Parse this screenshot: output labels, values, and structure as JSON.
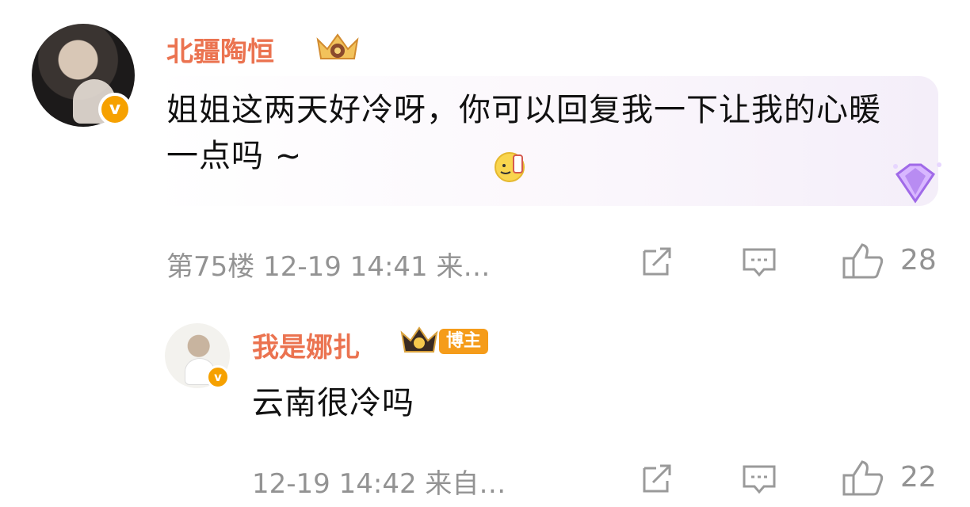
{
  "comments": [
    {
      "username": "北疆陶恒",
      "text": "姐姐这两天好冷呀，你可以回复我一下让我的心暖一点吗 ~",
      "meta": "第75楼 12-19 14:41 来…",
      "likes": "28",
      "icons": [
        "crown-badge-icon",
        "verified-icon",
        "emoji-icon",
        "diamond-icon",
        "share-icon",
        "comment-icon",
        "like-icon"
      ]
    },
    {
      "username": "我是娜扎",
      "badge": "博主",
      "text": "云南很冷吗",
      "meta": "12-19 14:42 来自…",
      "likes": "22",
      "icons": [
        "crown-badge-icon",
        "verified-icon",
        "share-icon",
        "comment-icon",
        "like-icon"
      ]
    }
  ],
  "colors": {
    "username": "#eb7350",
    "meta": "#939393",
    "badge_bg": "#f59c1a",
    "verified": "#f6a100"
  }
}
